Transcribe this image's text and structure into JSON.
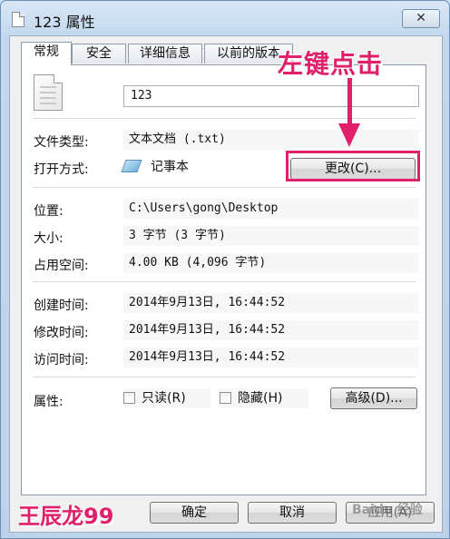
{
  "window": {
    "title": "123 属性",
    "close_glyph": "✕"
  },
  "tabs": [
    {
      "label": "常规",
      "active": true
    },
    {
      "label": "安全",
      "active": false
    },
    {
      "label": "详细信息",
      "active": false
    },
    {
      "label": "以前的版本",
      "active": false
    }
  ],
  "file": {
    "name": "123"
  },
  "general": {
    "type_label": "文件类型:",
    "type_value": "文本文档 (.txt)",
    "opens_label": "打开方式:",
    "opens_value": "记事本",
    "change_button": "更改(C)...",
    "location_label": "位置:",
    "location_value": "C:\\Users\\gong\\Desktop",
    "size_label": "大小:",
    "size_value": "3 字节 (3 字节)",
    "disk_label": "占用空间:",
    "disk_value": "4.00 KB (4,096 字节)",
    "created_label": "创建时间:",
    "created_value": "2014年9月13日, 16:44:52",
    "modified_label": "修改时间:",
    "modified_value": "2014年9月13日, 16:44:52",
    "accessed_label": "访问时间:",
    "accessed_value": "2014年9月13日, 16:44:52",
    "attributes_label": "属性:",
    "readonly_label": "只读(R)",
    "readonly_checked": false,
    "hidden_label": "隐藏(H)",
    "hidden_checked": false,
    "advanced_button": "高级(D)..."
  },
  "footer": {
    "ok": "确定",
    "cancel": "取消",
    "apply": "应用(A)"
  },
  "annotations": {
    "callout": "左键点击",
    "author": "王辰龙99",
    "logo_text": "Baidu 经验"
  },
  "colors": {
    "annotation": "#e0206a"
  }
}
